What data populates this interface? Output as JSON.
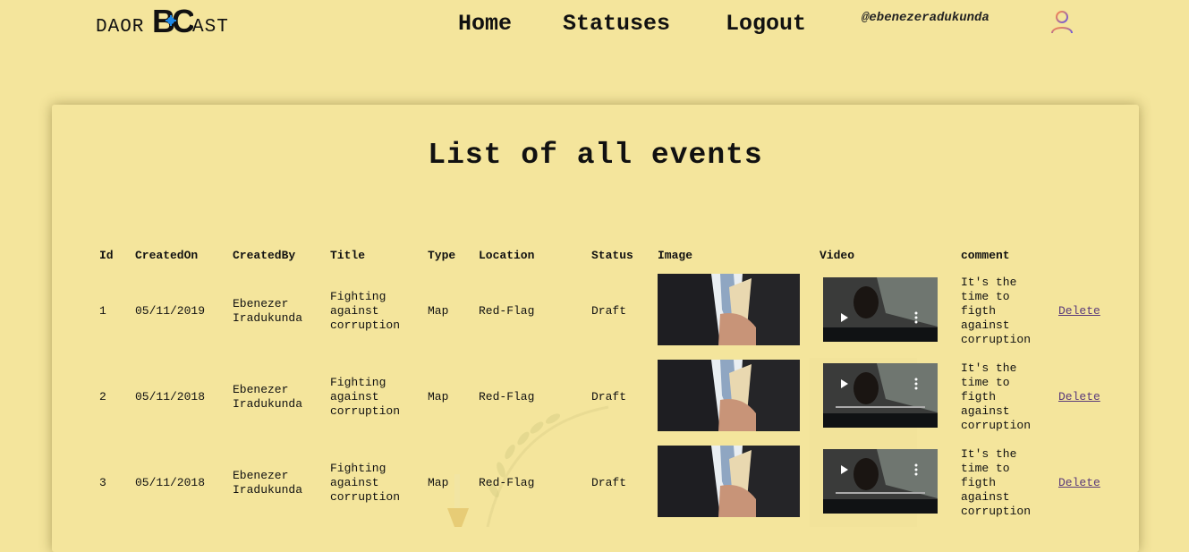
{
  "brand": {
    "left": "DAOR",
    "mark": "BC",
    "right": "AST"
  },
  "nav": {
    "home": "Home",
    "statuses": "Statuses",
    "logout": "Logout"
  },
  "user": {
    "handle": "@ebenezeradukunda"
  },
  "colors": {
    "background": "#f4e59c",
    "accent": "#1e88e5",
    "link": "#5a3a7a"
  },
  "page": {
    "title": "List of all events"
  },
  "table": {
    "headers": [
      "Id",
      "CreatedOn",
      "CreatedBy",
      "Title",
      "Type",
      "Location",
      "Status",
      "Image",
      "Video",
      "comment"
    ],
    "delete_label": "Delete",
    "rows": [
      {
        "id": "1",
        "created_on": "05/11/2019",
        "created_by_1": "Ebenezer",
        "created_by_2": "Iradukunda",
        "title_1": "Fighting",
        "title_2": "against",
        "title_3": "corruption",
        "type": "Map",
        "location": "Red-Flag",
        "status": "Draft",
        "comment_1": "It's the",
        "comment_2": "time to",
        "comment_3": "figth",
        "comment_4": "against",
        "comment_5": "corruption"
      },
      {
        "id": "2",
        "created_on": "05/11/2018",
        "created_by_1": "Ebenezer",
        "created_by_2": "Iradukunda",
        "title_1": "Fighting",
        "title_2": "against",
        "title_3": "corruption",
        "type": "Map",
        "location": "Red-Flag",
        "status": "Draft",
        "comment_1": "It's the",
        "comment_2": "time to",
        "comment_3": "figth",
        "comment_4": "against",
        "comment_5": "corruption"
      },
      {
        "id": "3",
        "created_on": "05/11/2018",
        "created_by_1": "Ebenezer",
        "created_by_2": "Iradukunda",
        "title_1": "Fighting",
        "title_2": "against",
        "title_3": "corruption",
        "type": "Map",
        "location": "Red-Flag",
        "status": "Draft",
        "comment_1": "It's the",
        "comment_2": "time to",
        "comment_3": "figth",
        "comment_4": "against",
        "comment_5": "corruption"
      }
    ]
  }
}
